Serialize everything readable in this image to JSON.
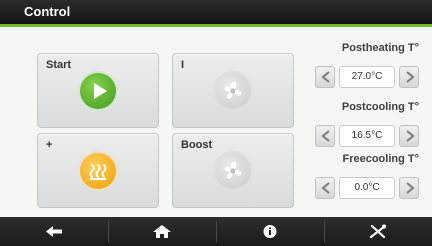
{
  "header": {
    "title": "Control"
  },
  "tiles": [
    {
      "label": "Start",
      "icon": "play-icon",
      "color": "#4caf2a"
    },
    {
      "label": "I",
      "icon": "fan-icon",
      "color": "#cfd2d2"
    },
    {
      "label": "+",
      "icon": "heater-icon",
      "color": "#f2a80f"
    },
    {
      "label": "Boost",
      "icon": "fan-icon",
      "color": "#cfd2d2"
    }
  ],
  "controls": [
    {
      "label": "Postheating T°",
      "value": "27.0°C"
    },
    {
      "label": "Postcooling T°",
      "value": "16.5°C"
    },
    {
      "label": "Freecooling T°",
      "value": "0.0°C"
    }
  ],
  "footer": {
    "items": [
      {
        "icon": "back-arrow-icon"
      },
      {
        "icon": "home-icon"
      },
      {
        "icon": "info-icon"
      },
      {
        "icon": "tools-icon"
      }
    ]
  },
  "colors": {
    "accent": "#6fbf2e",
    "header_bg": "#1f1f1f",
    "page_bg": "#f6f7f5"
  }
}
